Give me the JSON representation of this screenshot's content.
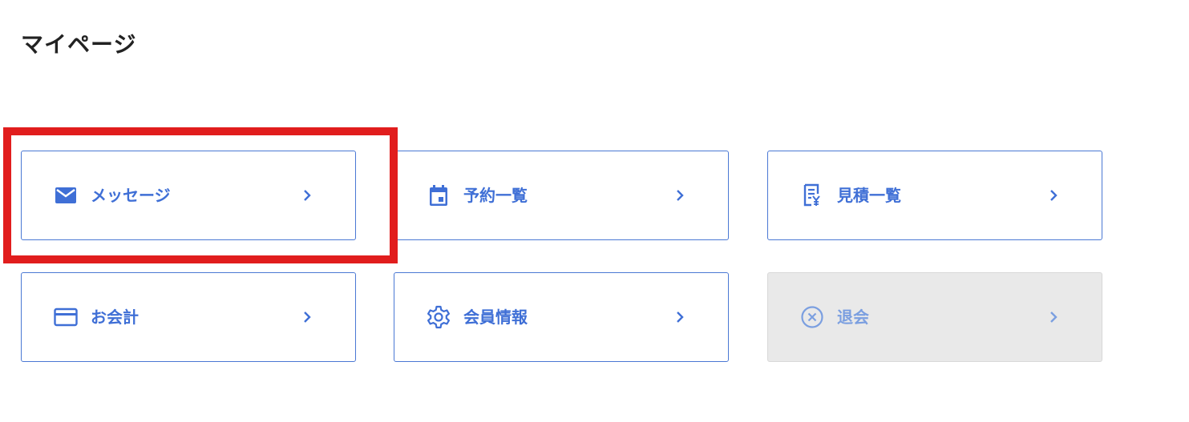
{
  "page": {
    "title": "マイページ"
  },
  "colors": {
    "accent": "#3f6fd6",
    "border": "#4a78d4",
    "disabled_bg": "#e9e9e9",
    "highlight": "#e11d1d"
  },
  "menu": {
    "items": [
      {
        "label": "メッセージ",
        "icon": "mail-icon",
        "enabled": true
      },
      {
        "label": "予約一覧",
        "icon": "calendar-icon",
        "enabled": true
      },
      {
        "label": "見積一覧",
        "icon": "estimate-receipt-icon",
        "enabled": true
      },
      {
        "label": "お会計",
        "icon": "credit-card-icon",
        "enabled": true
      },
      {
        "label": "会員情報",
        "icon": "gear-icon",
        "enabled": true
      },
      {
        "label": "退会",
        "icon": "cancel-circle-icon",
        "enabled": false
      }
    ]
  },
  "annotation": {
    "highlighted_item": "メッセージ"
  }
}
